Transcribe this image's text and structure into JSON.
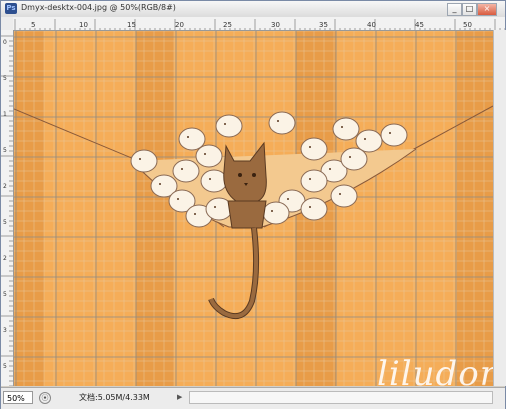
{
  "window": {
    "title": "Dmyx-desktx-004.jpg @ 50%(RGB/8#)",
    "app_icon": "Ps",
    "buttons": {
      "minimize": "_",
      "maximize": "□",
      "close": "×"
    }
  },
  "ruler_top": {
    "labels": [
      "5",
      "10",
      "15",
      "20",
      "25",
      "30",
      "35",
      "40",
      "45",
      "50"
    ]
  },
  "ruler_left": {
    "labels": [
      "0",
      "5",
      "1",
      "5",
      "2",
      "5",
      "2",
      "5",
      "3",
      "5"
    ]
  },
  "status": {
    "zoom": "50%",
    "doc_info": "文档:5.05M/4.33M",
    "arrow_right": "▶",
    "arrow_left": "◀"
  },
  "watermark": "liludori.co",
  "colors": {
    "canvas": "#f5ad58",
    "grid_light": "#e6c79e",
    "grid_dark": "#8c8a88",
    "cat": "#9a6a3f"
  }
}
